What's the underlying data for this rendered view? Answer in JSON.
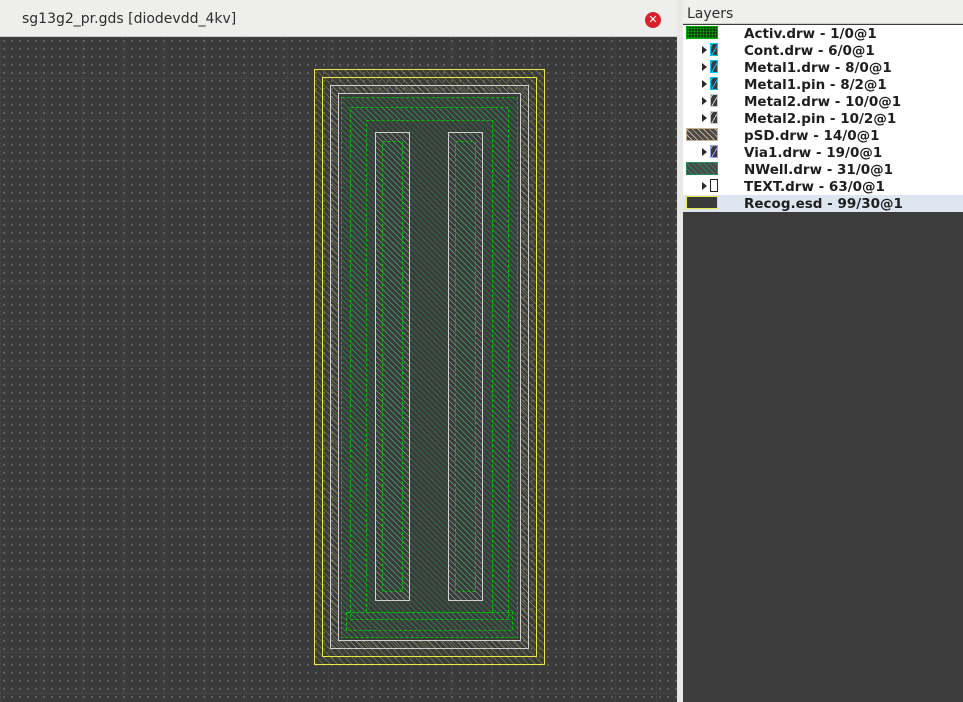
{
  "tab": {
    "title": "sg13g2_pr.gds [diodevdd_4kv]",
    "close_glyph": "✕"
  },
  "panel": {
    "title": "Layers",
    "layers": [
      {
        "label": "Activ.drw - 1/0@1",
        "has_arrow": false,
        "color": "#00b000",
        "swatch": "wide-dots"
      },
      {
        "label": "Cont.drw - 6/0@1",
        "has_arrow": true,
        "color": "#00c8ff",
        "swatch": "small-diag"
      },
      {
        "label": "Metal1.drw - 8/0@1",
        "has_arrow": true,
        "color": "#00c8ff",
        "swatch": "small-diag"
      },
      {
        "label": "Metal1.pin - 8/2@1",
        "has_arrow": true,
        "color": "#00c8ff",
        "swatch": "small-diag"
      },
      {
        "label": "Metal2.drw - 10/0@1",
        "has_arrow": true,
        "color": "#cccccc",
        "swatch": "small-diag"
      },
      {
        "label": "Metal2.pin - 10/2@1",
        "has_arrow": true,
        "color": "#cccccc",
        "swatch": "small-diag"
      },
      {
        "label": "pSD.drw - 14/0@1",
        "has_arrow": false,
        "color": "#c8b090",
        "swatch": "wide-diag"
      },
      {
        "label": "Via1.drw - 19/0@1",
        "has_arrow": true,
        "color": "#a0a0ff",
        "swatch": "small-diag"
      },
      {
        "label": "NWell.drw - 31/0@1",
        "has_arrow": false,
        "color": "#2a8a5a",
        "swatch": "wide-diag"
      },
      {
        "label": "TEXT.drw - 63/0@1",
        "has_arrow": true,
        "color": "#ffffff",
        "swatch": "small-empty"
      },
      {
        "label": "Recog.esd - 99/30@1",
        "has_arrow": false,
        "color": "#e8e840",
        "swatch": "wide-outline",
        "selected": true
      }
    ]
  },
  "colors": {
    "canvas_bg": "#3b3b3b",
    "activ": "#00c000",
    "recog": "#e8e840",
    "metal": "#d0d0d0",
    "psd": "#c8b090"
  }
}
